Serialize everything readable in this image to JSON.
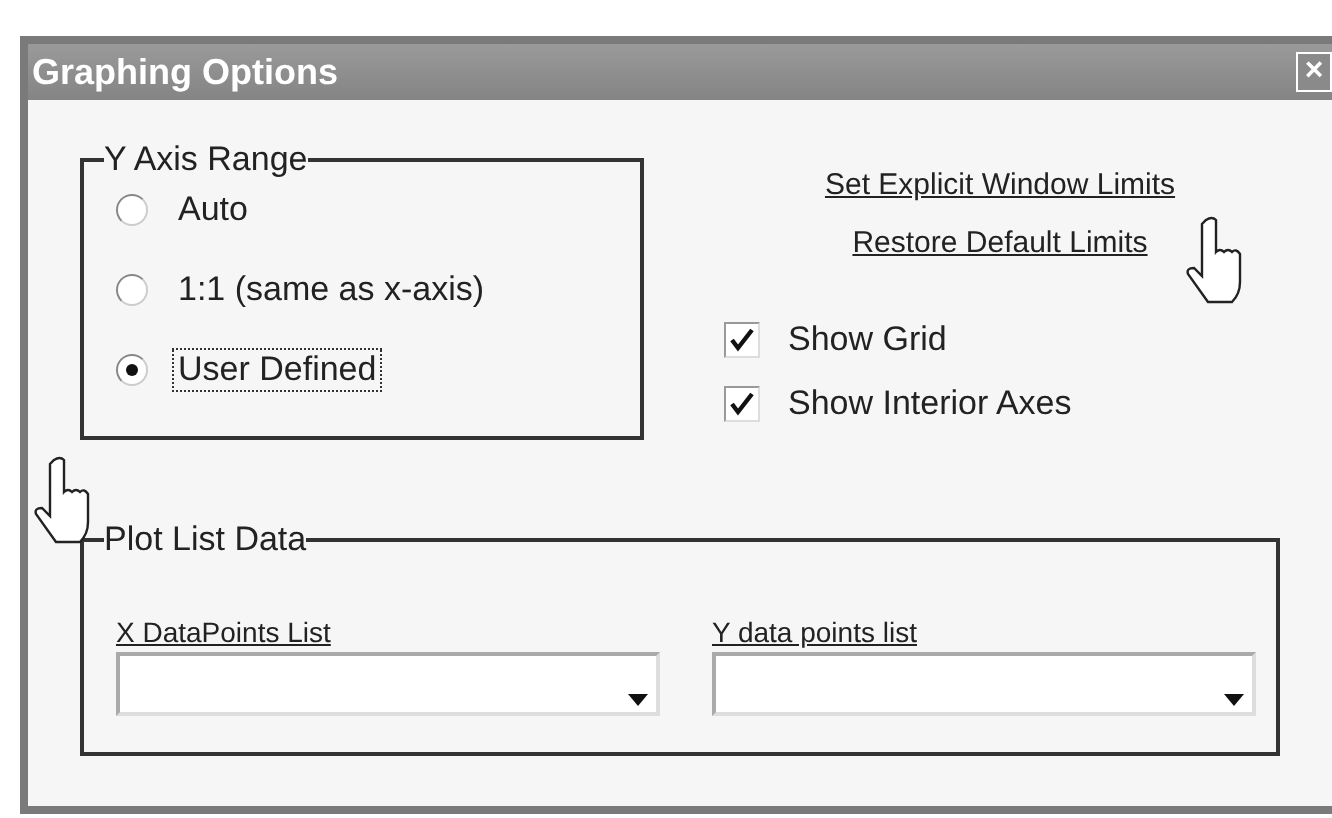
{
  "window": {
    "title": "Graphing Options",
    "close_label": "×"
  },
  "y_axis_range": {
    "title": "Y Axis Range",
    "options": [
      {
        "label": "Auto",
        "selected": false
      },
      {
        "label": "1:1 (same as x-axis)",
        "selected": false
      },
      {
        "label": "User Defined",
        "selected": true,
        "focused": true
      }
    ]
  },
  "links": [
    "Set Explicit Window Limits",
    "Restore Default Limits"
  ],
  "checkboxes": [
    {
      "label": "Show Grid",
      "checked": true
    },
    {
      "label": "Show Interior Axes",
      "checked": true
    }
  ],
  "plot_list_data": {
    "title": "Plot List Data",
    "fields": [
      {
        "label": "X DataPoints List"
      },
      {
        "label": "Y data points list"
      }
    ]
  }
}
